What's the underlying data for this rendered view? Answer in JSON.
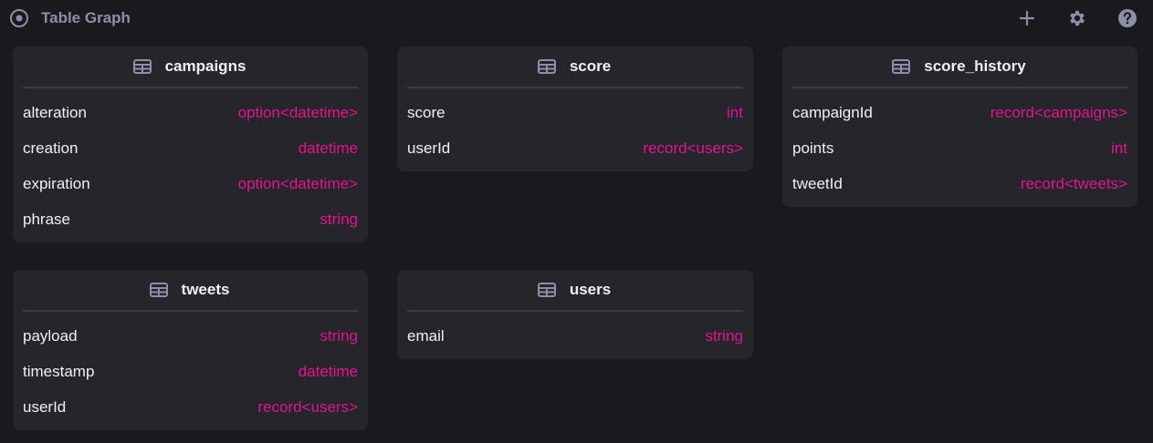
{
  "header": {
    "title": "Table Graph",
    "icons": [
      "radio-target-icon",
      "plus-icon",
      "gear-icon",
      "help-icon"
    ]
  },
  "colors": {
    "background": "#1a1a1e",
    "card": "#25252b",
    "type_accent": "#e0168f",
    "header_muted": "#8d8fa8"
  },
  "tables": [
    {
      "name": "campaigns",
      "fields": [
        {
          "name": "alteration",
          "type": "option<datetime>"
        },
        {
          "name": "creation",
          "type": "datetime"
        },
        {
          "name": "expiration",
          "type": "option<datetime>"
        },
        {
          "name": "phrase",
          "type": "string"
        }
      ]
    },
    {
      "name": "score",
      "fields": [
        {
          "name": "score",
          "type": "int"
        },
        {
          "name": "userId",
          "type": "record<users>"
        }
      ]
    },
    {
      "name": "score_history",
      "fields": [
        {
          "name": "campaignId",
          "type": "record<campaigns>"
        },
        {
          "name": "points",
          "type": "int"
        },
        {
          "name": "tweetId",
          "type": "record<tweets>"
        }
      ]
    },
    {
      "name": "tweets",
      "fields": [
        {
          "name": "payload",
          "type": "string"
        },
        {
          "name": "timestamp",
          "type": "datetime"
        },
        {
          "name": "userId",
          "type": "record<users>"
        }
      ]
    },
    {
      "name": "users",
      "fields": [
        {
          "name": "email",
          "type": "string"
        }
      ]
    }
  ]
}
